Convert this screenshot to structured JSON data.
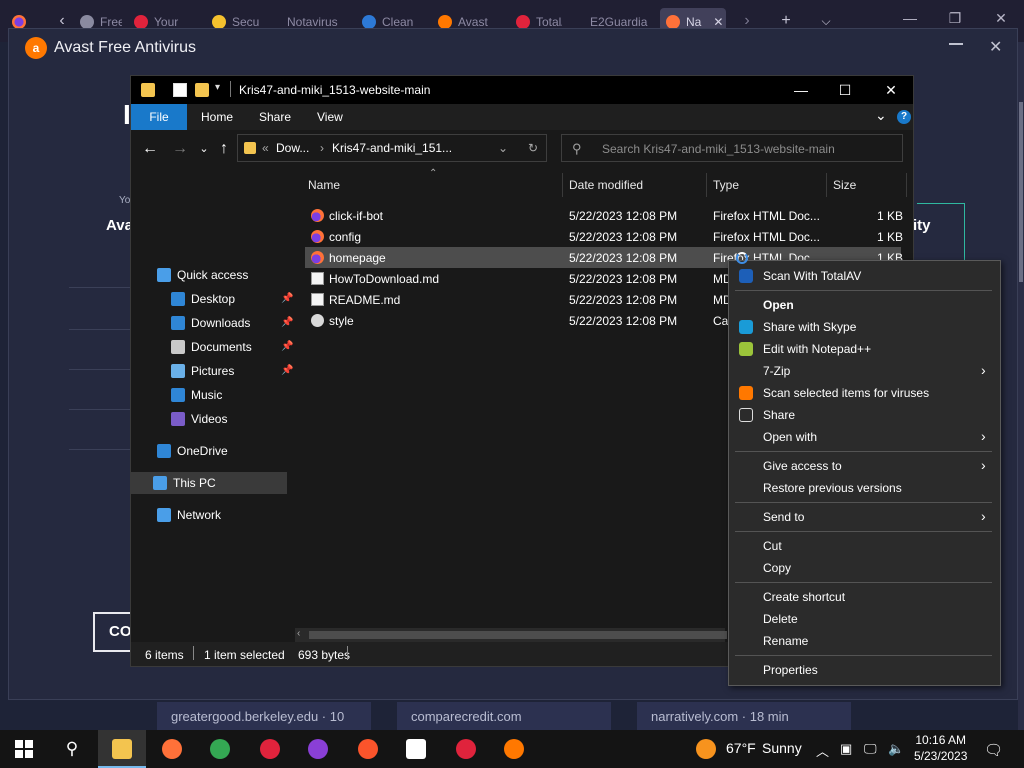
{
  "browser": {
    "tabs": [
      {
        "label": "Freec",
        "color": "#8a8aa0"
      },
      {
        "label": "Your",
        "color": "#e0233c"
      },
      {
        "label": "Secu",
        "color": "#f5c12e"
      },
      {
        "label": "Notavirus",
        "color": ""
      },
      {
        "label": "Clean",
        "color": "#2d79d6"
      },
      {
        "label": "Avast",
        "color": "#ff7800"
      },
      {
        "label": "Total/",
        "color": "#e0233c"
      },
      {
        "label": "E2Guardia",
        "color": ""
      },
      {
        "label": "Na",
        "color": "#ff7139"
      }
    ],
    "tab_close": "✕",
    "new_tab": "+",
    "suggestions": [
      "greatergood.berkeley.edu · 10",
      "comparecredit.com",
      "narratively.com · 18 min"
    ]
  },
  "avast": {
    "title": "Avast Free Antivirus",
    "fragment_left": "Ava",
    "fragment_small": "Yo",
    "fragment_right": "ity",
    "fragment_top": "I",
    "button_label": "CON"
  },
  "explorer": {
    "title": "Kris47-and-miki_1513-website-main",
    "ribbon_tabs": [
      "File",
      "Home",
      "Share",
      "View"
    ],
    "address_prefix": "«",
    "address": [
      "Dow...",
      "Kris47-and-miki_151..."
    ],
    "search_placeholder": "Search Kris47-and-miki_1513-website-main",
    "nav": [
      {
        "label": "Quick access",
        "icon": "star-icon",
        "color": "#4a9ee8",
        "pinned": false
      },
      {
        "label": "Desktop",
        "icon": "desktop-icon",
        "color": "#2f86d6",
        "pinned": true
      },
      {
        "label": "Downloads",
        "icon": "download-icon",
        "color": "#2f86d6",
        "pinned": true
      },
      {
        "label": "Documents",
        "icon": "document-icon",
        "color": "#c9c9c9",
        "pinned": true
      },
      {
        "label": "Pictures",
        "icon": "picture-icon",
        "color": "#6ab0e8",
        "pinned": true
      },
      {
        "label": "Music",
        "icon": "music-icon",
        "color": "#2f86d6",
        "pinned": false
      },
      {
        "label": "Videos",
        "icon": "video-icon",
        "color": "#7a5cc8",
        "pinned": false
      },
      {
        "label": "OneDrive",
        "icon": "cloud-icon",
        "color": "#2f86d6",
        "pinned": false
      },
      {
        "label": "This PC",
        "icon": "computer-icon",
        "color": "#4a9ee8",
        "pinned": false
      },
      {
        "label": "Network",
        "icon": "network-icon",
        "color": "#4a9ee8",
        "pinned": false
      }
    ],
    "columns": [
      "Name",
      "Date modified",
      "Type",
      "Size"
    ],
    "files": [
      {
        "name": "click-if-bot",
        "date": "5/22/2023 12:08 PM",
        "type": "Firefox HTML Doc...",
        "size": "1 KB",
        "icon": "ff"
      },
      {
        "name": "config",
        "date": "5/22/2023 12:08 PM",
        "type": "Firefox HTML Doc...",
        "size": "1 KB",
        "icon": "ff"
      },
      {
        "name": "homepage",
        "date": "5/22/2023 12:08 PM",
        "type": "Firefox HTML Doc...",
        "size": "1 KB",
        "icon": "ff"
      },
      {
        "name": "HowToDownload.md",
        "date": "5/22/2023 12:08 PM",
        "type": "MD",
        "size": "",
        "icon": "doc"
      },
      {
        "name": "README.md",
        "date": "5/22/2023 12:08 PM",
        "type": "MD",
        "size": "",
        "icon": "doc"
      },
      {
        "name": "style",
        "date": "5/22/2023 12:08 PM",
        "type": "Cas",
        "size": "",
        "icon": "css"
      }
    ],
    "selected_file": "homepage",
    "status": {
      "items": "6 items",
      "selection": "1 item selected",
      "size": "693 bytes"
    }
  },
  "context_menu": {
    "groups": [
      [
        {
          "label": "Scan With TotalAV",
          "icon": "totalav-icon",
          "color": "#1d5fb8",
          "sub": false,
          "bold": false
        }
      ],
      [
        {
          "label": "Open",
          "icon": "",
          "color": "",
          "sub": false,
          "bold": true
        },
        {
          "label": "Share with Skype",
          "icon": "skype-icon",
          "color": "#1a9bd7",
          "sub": false,
          "bold": false
        },
        {
          "label": "Edit with Notepad++",
          "icon": "notepadpp-icon",
          "color": "#9bc43a",
          "sub": false,
          "bold": false
        },
        {
          "label": "7-Zip",
          "icon": "",
          "color": "",
          "sub": true,
          "bold": false
        },
        {
          "label": "Scan selected items for viruses",
          "icon": "avast-icon",
          "color": "#ff7800",
          "sub": false,
          "bold": false
        },
        {
          "label": "Share",
          "icon": "share-icon",
          "color": "",
          "sub": false,
          "bold": false
        },
        {
          "label": "Open with",
          "icon": "",
          "color": "",
          "sub": true,
          "bold": false
        }
      ],
      [
        {
          "label": "Give access to",
          "icon": "",
          "color": "",
          "sub": true,
          "bold": false
        },
        {
          "label": "Restore previous versions",
          "icon": "",
          "color": "",
          "sub": false,
          "bold": false
        }
      ],
      [
        {
          "label": "Send to",
          "icon": "",
          "color": "",
          "sub": true,
          "bold": false
        }
      ],
      [
        {
          "label": "Cut",
          "icon": "",
          "color": "",
          "sub": false,
          "bold": false
        },
        {
          "label": "Copy",
          "icon": "",
          "color": "",
          "sub": false,
          "bold": false
        }
      ],
      [
        {
          "label": "Create shortcut",
          "icon": "",
          "color": "",
          "sub": false,
          "bold": false
        },
        {
          "label": "Delete",
          "icon": "",
          "color": "",
          "sub": false,
          "bold": false
        },
        {
          "label": "Rename",
          "icon": "",
          "color": "",
          "sub": false,
          "bold": false
        }
      ],
      [
        {
          "label": "Properties",
          "icon": "",
          "color": "",
          "sub": false,
          "bold": false
        }
      ]
    ]
  },
  "taskbar": {
    "weather_temp": "67°F",
    "weather_desc": "Sunny",
    "time": "10:16 AM",
    "date": "5/23/2023",
    "apps": [
      {
        "name": "file-explorer-icon",
        "color": "#f3c44f"
      },
      {
        "name": "firefox-icon",
        "color": "#ff7139"
      },
      {
        "name": "chrome-icon",
        "color": "#34a853"
      },
      {
        "name": "video-editor-icon",
        "color": "#e0233c"
      },
      {
        "name": "mask-app-icon",
        "color": "#8a3fd6"
      },
      {
        "name": "brave-icon",
        "color": "#fb542b"
      },
      {
        "name": "clapper-icon",
        "color": "#ffffff"
      },
      {
        "name": "shield-app-icon",
        "color": "#e0233c"
      },
      {
        "name": "avast-icon",
        "color": "#ff7800"
      }
    ]
  }
}
